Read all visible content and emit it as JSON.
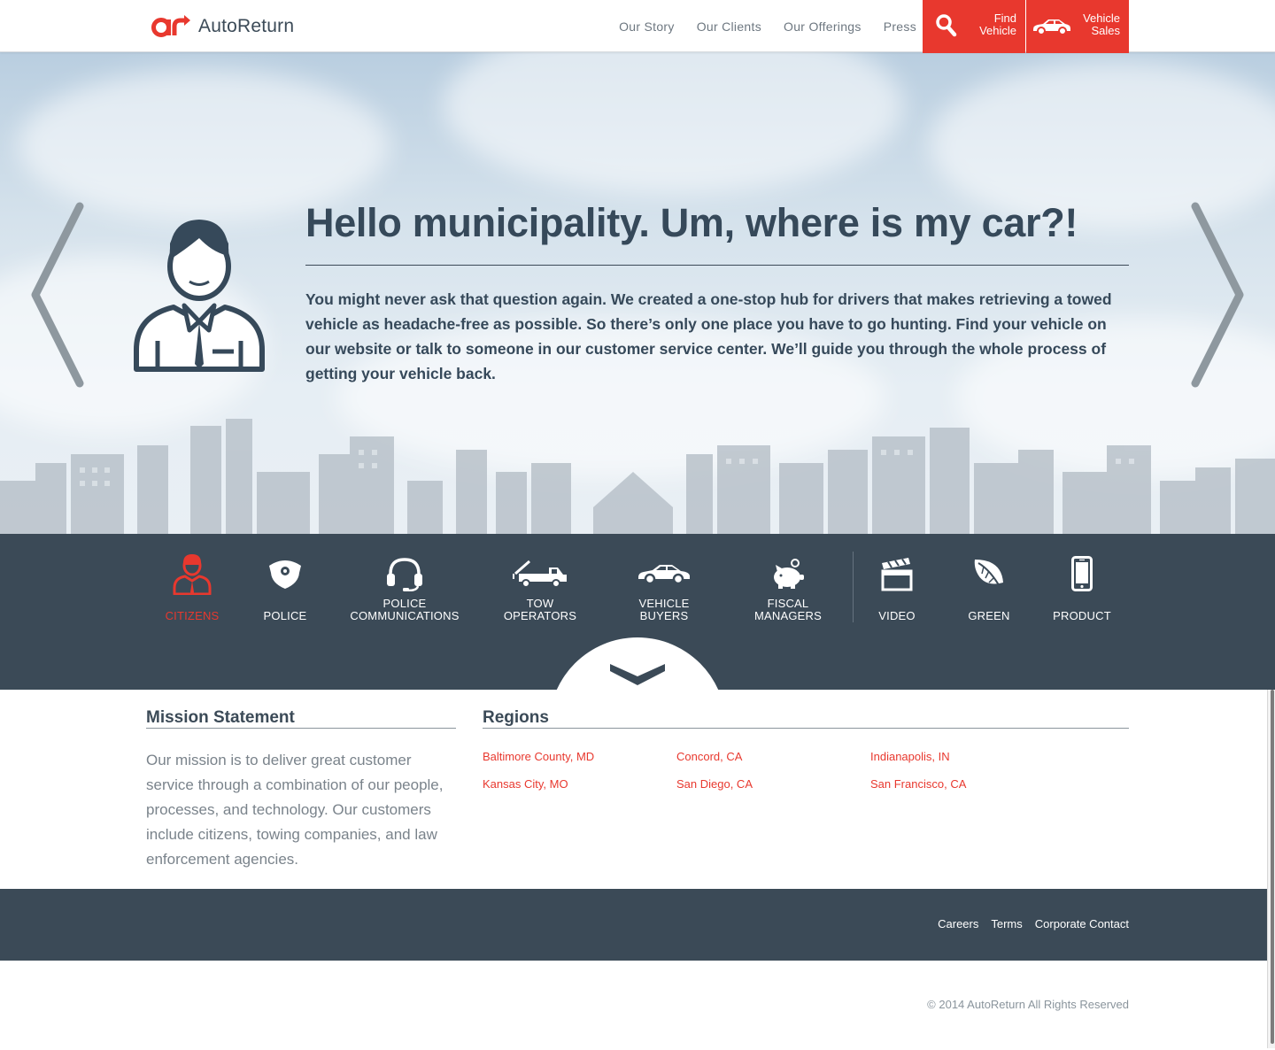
{
  "header": {
    "logo_text": "AutoReturn",
    "nav": [
      "Our Story",
      "Our Clients",
      "Our Offerings",
      "Press"
    ],
    "find_vehicle": {
      "line1": "Find",
      "line2": "Vehicle",
      "icon": "search-icon"
    },
    "vehicle_sales": {
      "line1": "Vehicle",
      "line2": "Sales",
      "icon": "car-icon"
    }
  },
  "hero": {
    "title": "Hello municipality. Um, where is my car?!",
    "body": "You might never ask that question again. We created a one-stop hub for drivers that makes retrieving a towed vehicle as headache-free as possible. So there’s only one place you have to go hunting. Find your vehicle on our website or talk to someone in our customer service center. We’ll guide you through the whole process of getting your vehicle back."
  },
  "categories": [
    {
      "line1": "",
      "line2": "CITIZENS",
      "icon": "citizen-icon",
      "active": true
    },
    {
      "line1": "",
      "line2": "POLICE",
      "icon": "police-badge-icon"
    },
    {
      "line1": "POLICE",
      "line2": "COMMUNICATIONS",
      "icon": "headset-icon"
    },
    {
      "line1": "TOW",
      "line2": "OPERATORS",
      "icon": "tow-truck-icon"
    },
    {
      "line1": "VEHICLE",
      "line2": "BUYERS",
      "icon": "car-icon"
    },
    {
      "line1": "FISCAL",
      "line2": "MANAGERS",
      "icon": "piggy-bank-icon"
    },
    {
      "line1": "",
      "line2": "VIDEO",
      "icon": "clapperboard-icon"
    },
    {
      "line1": "",
      "line2": "GREEN",
      "icon": "leaf-icon"
    },
    {
      "line1": "",
      "line2": "PRODUCT",
      "icon": "phone-icon"
    }
  ],
  "mission": {
    "title": "Mission Statement",
    "text": "Our mission is to deliver great customer service through a combination of our people, processes, and technology. Our customers include citizens, towing companies, and law enforcement agencies."
  },
  "regions": {
    "title": "Regions",
    "items": [
      "Baltimore County, MD",
      "Concord, CA",
      "Indianapolis, IN",
      "Kansas City, MO",
      "San Diego, CA",
      "San Francisco, CA"
    ]
  },
  "footer": {
    "links": [
      "Careers",
      "Terms",
      "Corporate Contact"
    ],
    "copyright": "© 2014 AutoReturn All Rights Reserved"
  },
  "colors": {
    "brand_red": "#e8382e",
    "slate": "#3b4a57"
  }
}
